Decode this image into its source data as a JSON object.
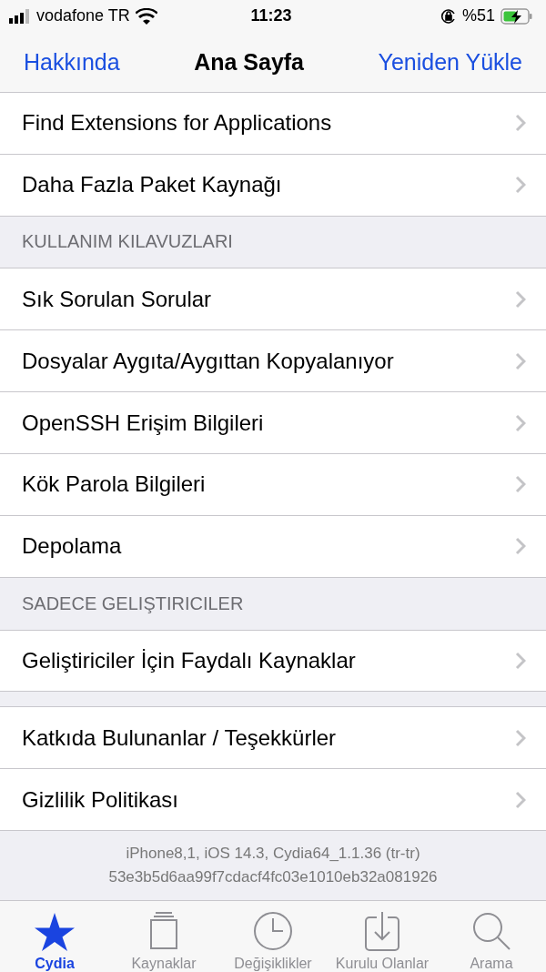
{
  "status_bar": {
    "carrier": "vodafone TR",
    "time": "11:23",
    "battery": "%51"
  },
  "nav": {
    "left": "Hakkında",
    "title": "Ana Sayfa",
    "right": "Yeniden Yükle"
  },
  "sections": [
    {
      "rows": [
        "Find Extensions for Applications",
        "Daha Fazla Paket Kaynağı"
      ]
    },
    {
      "header": "KULLANIM KILAVUZLARI",
      "rows": [
        "Sık Sorulan Sorular",
        "Dosyalar Aygıta/Aygıttan Kopyalanıyor",
        "OpenSSH Erişim Bilgileri",
        "Kök Parola Bilgileri",
        "Depolama"
      ]
    },
    {
      "header": "SADECE GELIŞTIRICILER",
      "rows": [
        "Geliştiriciler İçin Faydalı Kaynaklar"
      ]
    },
    {
      "rows": [
        "Katkıda Bulunanlar / Teşekkürler",
        "Gizlilik Politikası"
      ]
    }
  ],
  "footer": [
    "iPhone8,1, iOS 14.3, Cydia64_1.1.36 (tr-tr)",
    "53e3b5d6aa99f7cdacf4fc03e1010eb32a081926"
  ],
  "tabs": [
    {
      "label": "Cydia",
      "selected": true
    },
    {
      "label": "Kaynaklar",
      "selected": false
    },
    {
      "label": "Değişiklikler",
      "selected": false
    },
    {
      "label": "Kurulu Olanlar",
      "selected": false
    },
    {
      "label": "Arama",
      "selected": false
    }
  ]
}
